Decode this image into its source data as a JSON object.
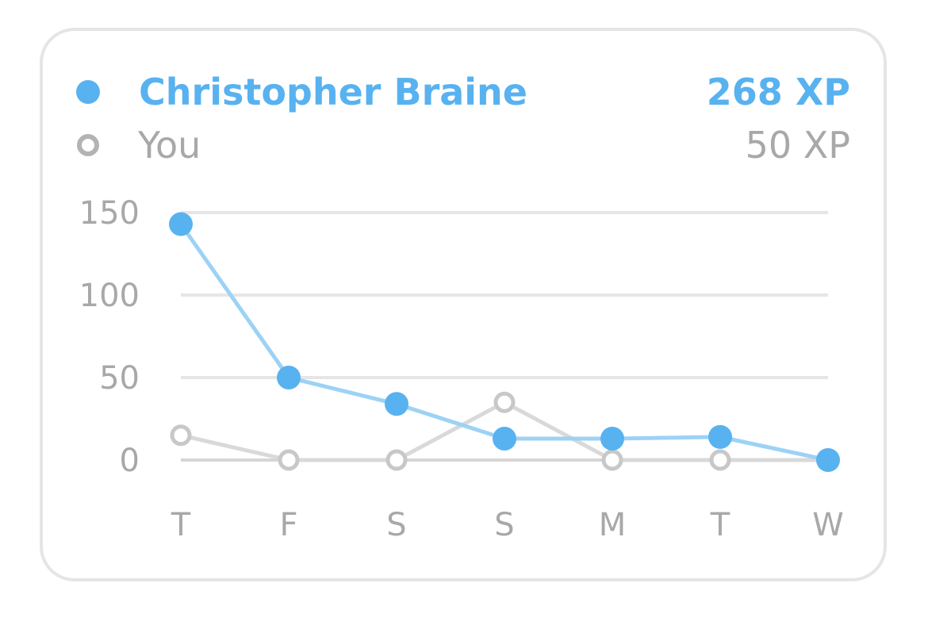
{
  "legend": [
    {
      "name": "Christopher Braine",
      "xp": "268 XP",
      "marker": "filled"
    },
    {
      "name": "You",
      "xp": "50 XP",
      "marker": "hollow"
    }
  ],
  "colors": {
    "series_primary": "#58b2f0",
    "series_primary_line": "#9dd2f5",
    "series_secondary": "#c8c8c8",
    "series_secondary_line": "#d9d9d9",
    "grid": "#e6e6e6",
    "axis_text": "#a8a8a8",
    "card_border": "#e5e5e5"
  },
  "chart_data": {
    "type": "line",
    "categories": [
      "T",
      "F",
      "S",
      "S",
      "M",
      "T",
      "W"
    ],
    "series": [
      {
        "name": "Christopher Braine",
        "values": [
          143,
          50,
          34,
          13,
          13,
          14,
          0
        ],
        "style": "filled"
      },
      {
        "name": "You",
        "values": [
          15,
          0,
          0,
          35,
          0,
          0,
          0
        ],
        "style": "hollow"
      }
    ],
    "yticks": [
      0,
      50,
      100,
      150
    ],
    "ylim": [
      0,
      150
    ],
    "grid": true,
    "legend_position": "top"
  }
}
